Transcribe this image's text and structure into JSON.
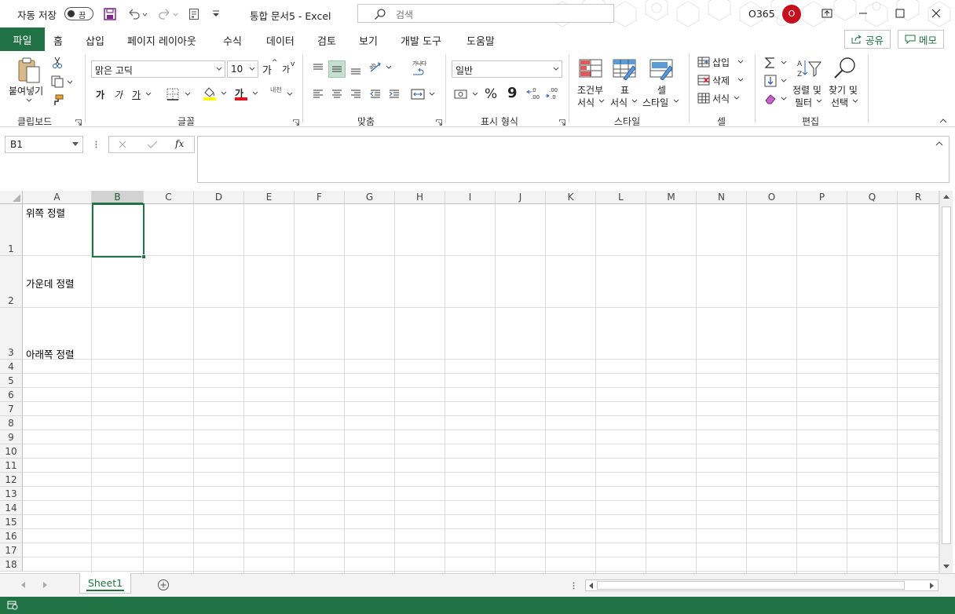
{
  "titlebar": {
    "autosave_label": "자동 저장",
    "autosave_state": "끔",
    "document_title": "통합 문서5  -  Excel",
    "search_placeholder": "검색",
    "account_label": "O365",
    "avatar_initial": "O"
  },
  "tabs": {
    "file": "파일",
    "items": [
      "홈",
      "삽입",
      "페이지 레이아웃",
      "수식",
      "데이터",
      "검토",
      "보기",
      "개발 도구",
      "도움말"
    ],
    "active": "홈",
    "share": "공유",
    "memo": "메모"
  },
  "ribbon": {
    "clipboard": {
      "paste": "붙여넣기",
      "label": "클립보드"
    },
    "font": {
      "font_name": "맑은 고딕",
      "font_size": "10",
      "grow": "가",
      "shrink": "가",
      "bold": "가",
      "italic": "가",
      "underline": "가",
      "font_color_glyph": "가",
      "phonetic": "내천",
      "label": "글꼴"
    },
    "alignment": {
      "wrap_glyph": "가나다",
      "label": "맞춤"
    },
    "number": {
      "format": "일반",
      "percent": "%",
      "comma": "9",
      "label": "표시 형식"
    },
    "styles": {
      "conditional": [
        "조건부",
        "서식"
      ],
      "table": [
        "표",
        "서식"
      ],
      "cell": [
        "셀",
        "스타일"
      ],
      "label": "스타일"
    },
    "cells": {
      "insert": "삽입",
      "delete": "삭제",
      "format": "서식",
      "label": "셀"
    },
    "editing": {
      "sort": [
        "정렬 및",
        "필터"
      ],
      "find": [
        "찾기 및",
        "선택"
      ],
      "label": "편집"
    }
  },
  "formula_bar": {
    "name_box": "B1",
    "fx": "fx",
    "content": ""
  },
  "grid": {
    "columns": [
      "A",
      "B",
      "C",
      "D",
      "E",
      "F",
      "G",
      "H",
      "I",
      "J",
      "K",
      "L",
      "M",
      "N",
      "O",
      "P",
      "Q",
      "R"
    ],
    "rows": [
      "1",
      "2",
      "3",
      "4",
      "5",
      "6",
      "7",
      "8",
      "9",
      "10",
      "11",
      "12",
      "13",
      "14",
      "15",
      "16",
      "17",
      "18"
    ],
    "selected_column": "B",
    "cells": {
      "A1": "위쪽 정렬",
      "A2": "가운데 정렬",
      "A3": "아래쪽 정렬"
    }
  },
  "sheets": {
    "tabs": [
      "Sheet1"
    ],
    "active": "Sheet1"
  },
  "colors": {
    "accent": "#217346",
    "selection": "#c6dfd0",
    "grid_line": "#dedede",
    "avatar": "#c50f1f"
  }
}
